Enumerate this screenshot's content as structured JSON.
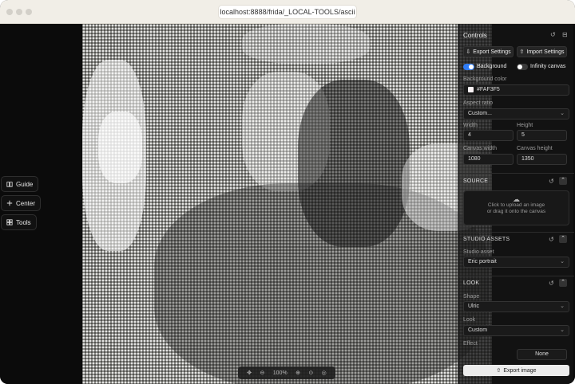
{
  "browser": {
    "url": "localhost:8888/frida/_LOCAL-TOOLS/ascii"
  },
  "left_tools": [
    {
      "label": "Guide",
      "icon": "book-icon"
    },
    {
      "label": "Center",
      "icon": "plus-icon"
    },
    {
      "label": "Tools",
      "icon": "grid-icon"
    }
  ],
  "zoom": {
    "value": "100%"
  },
  "controls": {
    "title": "Controls",
    "export_settings": "Export Settings",
    "import_settings": "Import Settings",
    "background_toggle": {
      "label": "Background",
      "on": true
    },
    "infinity_toggle": {
      "label": "Infinity canvas",
      "on": false
    },
    "background_color": {
      "label": "Background color",
      "value": "#FAF3F5"
    },
    "aspect_ratio": {
      "label": "Aspect ratio",
      "value": "Custom..."
    },
    "width": {
      "label": "Width",
      "value": "4"
    },
    "height": {
      "label": "Height",
      "value": "5"
    },
    "canvas_width": {
      "label": "Canvas width",
      "value": "1080"
    },
    "canvas_height": {
      "label": "Canvas height",
      "value": "1350"
    },
    "source": {
      "title": "SOURCE",
      "upload_line1": "Click to upload an image",
      "upload_line2": "or drag it onto the canvas"
    },
    "studio_assets": {
      "title": "STUDIO ASSETS",
      "label": "Studio asset",
      "value": "Eric portrait"
    },
    "look": {
      "title": "LOOK",
      "shape_label": "Shape",
      "shape_value": "Ulric",
      "look_label": "Look",
      "look_value": "Custom",
      "effect_label": "Effect",
      "effect_value": "None"
    },
    "export_image": "Export image"
  },
  "colors": {
    "accent": "#2f7cf6",
    "panel": "#141414",
    "canvas_bg": "#FAF3F5"
  }
}
